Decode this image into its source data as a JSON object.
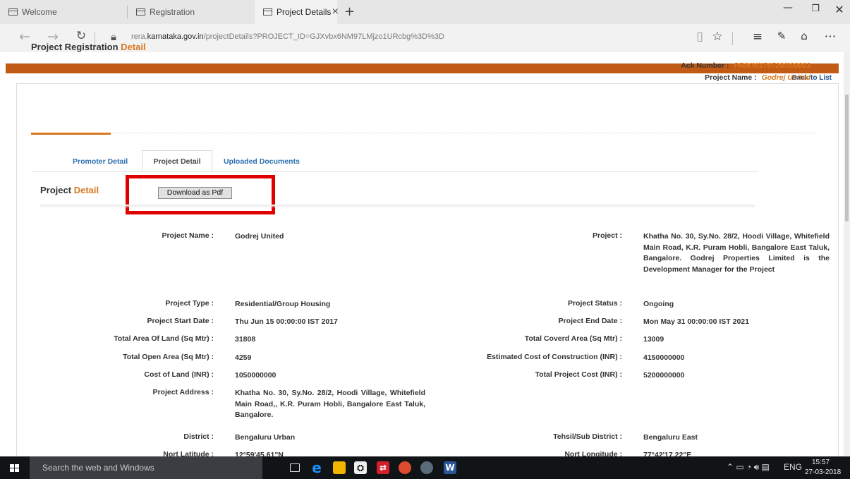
{
  "browser": {
    "tabs": [
      {
        "label": "Welcome"
      },
      {
        "label": "Registration"
      },
      {
        "label": "Project Details"
      }
    ],
    "new_tab": "+",
    "close_tab": "×",
    "url_prefix": "rera.",
    "url_domain": "karnataka.gov.in",
    "url_path": "/projectDetails?PROJECT_ID=GJXvbx6NM97LMjzo1URcbg%3D%3D"
  },
  "page": {
    "back_to_list": "Back to List",
    "registration_title": "Project Registration",
    "registration_title_accent": "Detail",
    "ack_label": "Ack Number :",
    "ack_value": "PR/KN/170729/000003",
    "project_name_label": "Project Name :",
    "project_name_value": "Godrej United",
    "tabs": {
      "promoter": "Promoter Detail",
      "project": "Project Detail",
      "documents": "Uploaded Documents"
    },
    "section_title": "Project",
    "section_title_accent": "Detail",
    "download_button": "Download as Pdf",
    "fields": {
      "project_name_label": "Project Name :",
      "project_name": "Godrej United",
      "project_label": "Project :",
      "project_desc": "Khatha No. 30, Sy.No. 28/2, Hoodi Village, Whitefield Main Road, K.R. Puram Hobli, Bangalore East Taluk, Bangalore. Godrej Properties Limited is the Development Manager for the Project",
      "project_type_label": "Project Type :",
      "project_type": "Residential/Group Housing",
      "project_status_label": "Project Status :",
      "project_status": "Ongoing",
      "start_date_label": "Project Start Date :",
      "start_date": "Thu Jun 15 00:00:00 IST 2017",
      "end_date_label": "Project End Date :",
      "end_date": "Mon May 31 00:00:00 IST 2021",
      "land_area_label": "Total Area Of Land (Sq Mtr) :",
      "land_area": "31808",
      "covered_area_label": "Total Coverd Area (Sq Mtr) :",
      "covered_area": "13009",
      "open_area_label": "Total Open Area (Sq Mtr) :",
      "open_area": "4259",
      "construction_cost_label": "Estimated Cost of Construction (INR) :",
      "construction_cost": "4150000000",
      "land_cost_label": "Cost of Land (INR) :",
      "land_cost": "1050000000",
      "total_cost_label": "Total Project Cost (INR) :",
      "total_cost": "5200000000",
      "address_label": "Project Address :",
      "address": "Khatha No. 30, Sy.No. 28/2, Hoodi Village, Whitefield Main Road,, K.R. Puram Hobli, Bangalore East Taluk, Bangalore.",
      "district_label": "District :",
      "district": "Bengaluru Urban",
      "tehsil_label": "Tehsil/Sub District :",
      "tehsil": "Bengaluru East",
      "latitude_label": "Nort Latitude :",
      "latitude": "12°59'45.61\"N",
      "longitude_label": "Nort Longitude :",
      "longitude": "77°42'17.22\"E"
    }
  },
  "taskbar": {
    "search_placeholder": "Search the web and Windows",
    "language": "ENG",
    "time": "15:57",
    "date": "27-03-2018"
  }
}
